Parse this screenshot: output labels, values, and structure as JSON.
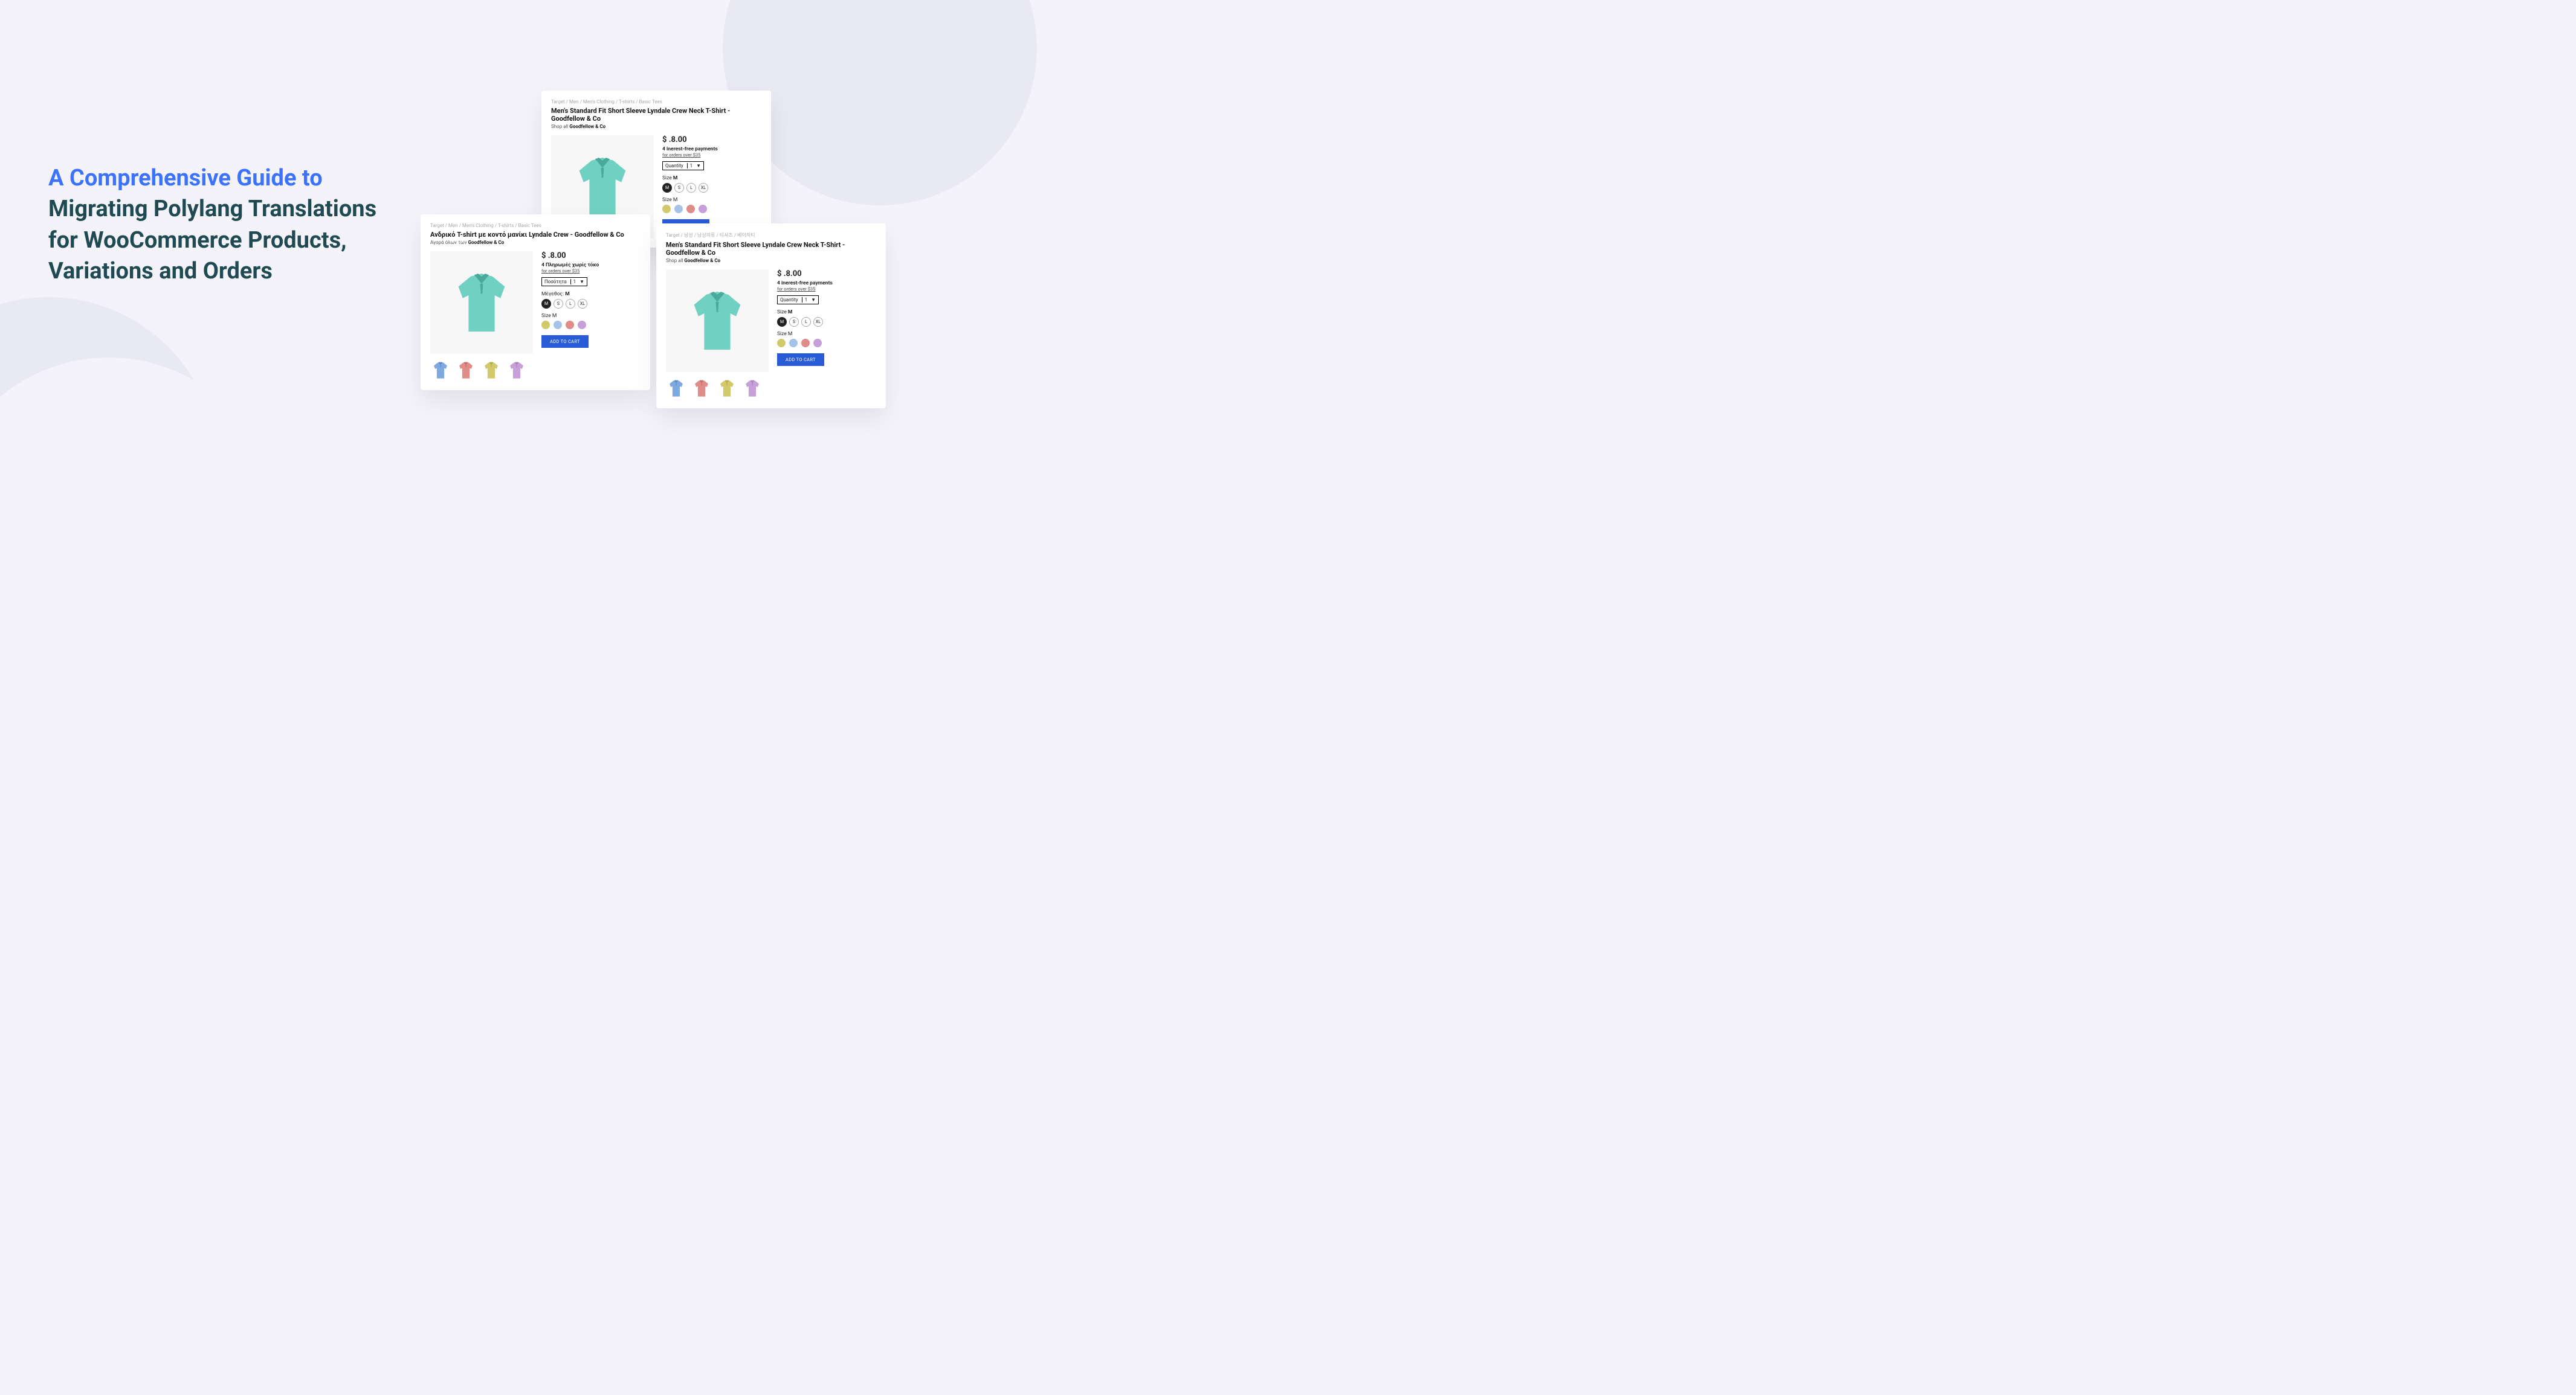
{
  "headline": {
    "line1": "A Comprehensive Guide to",
    "line2": "Migrating Polylang Translations for WooCommerce Products, Variations and Orders"
  },
  "common": {
    "price": "$ .8.00",
    "qty_value": "1",
    "size_M": "M",
    "size_S": "S",
    "size_L": "L",
    "size_XL": "XL",
    "selected_size": "M",
    "addcart": "ADD TO CART",
    "swatch_colors": [
      "#d2c96a",
      "#a6c2e8",
      "#e08c88",
      "#c79fd9"
    ],
    "thumb_colors": [
      "#7ea9e0",
      "#e08c88",
      "#d2c96a",
      "#c79fd9"
    ]
  },
  "cards": {
    "top": {
      "breadcrumb": "Target / Men / Men's Clothing / T-shirts / Basic Tees",
      "title": "Men's Standard Fit Short Sleeve Lyndale Crew Neck T-Shirt - Goodfellow & Co",
      "shopall_prefix": "Shop all ",
      "shopall_brand": "Goodfellow & Co",
      "payinfo": "4 inerest-free payments",
      "payinfo_sub": "for orders over $35",
      "qty_label": "Quantity",
      "size_label": "Size ",
      "size2_label": "Size M"
    },
    "left": {
      "breadcrumb": "Target / Men / Men's Clothing / T-shirts / Basic Tees",
      "title": "Ανδρικό T-shirt με κοντό μανίκι Lyndale Crew - Goodfellow & Co",
      "shopall_prefix": "Αγορά όλων των ",
      "shopall_brand": "Goodfellow & Co",
      "payinfo": "4 Πληρωμές χωρίς τόκο",
      "payinfo_sub": "for orders over $35",
      "qty_label": "Ποσότητα",
      "size_label": "Μέγεθος: ",
      "size2_label": "Size M"
    },
    "right": {
      "breadcrumb": "Target / 남성 / 남성의류 / 티셔츠 / 베이직티",
      "title": "Men's Standard Fit Short Sleeve Lyndale Crew Neck T-Shirt - Goodfellow & Co",
      "shopall_prefix": "Shop all ",
      "shopall_brand": "Goodfellow & Co",
      "payinfo": "4 inerest-free payments",
      "payinfo_sub": "for orders over $35",
      "qty_label": "Quantity",
      "size_label": "Size ",
      "size2_label": "Size M"
    }
  }
}
